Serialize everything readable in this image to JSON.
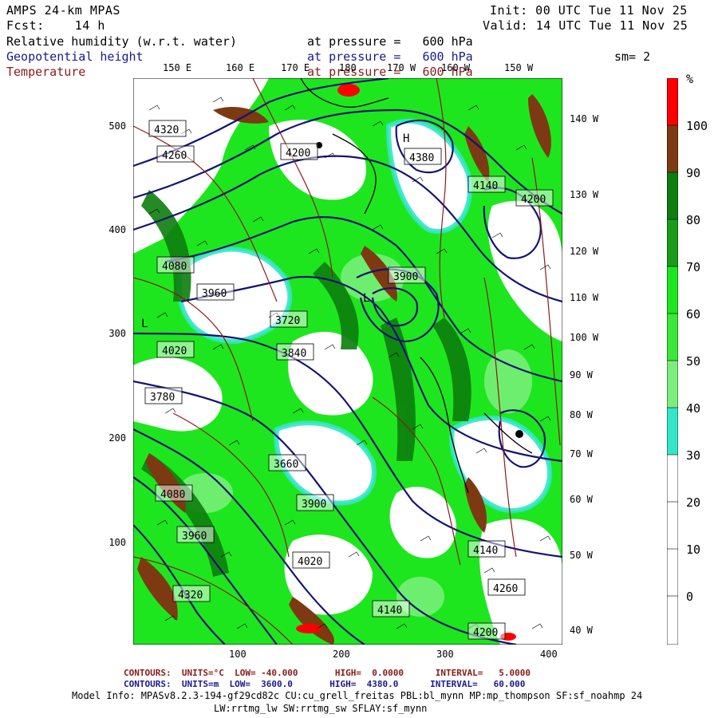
{
  "header": {
    "model": "AMPS 24-km MPAS",
    "fcst": "Fcst:    14 h",
    "init": "Init: 00 UTC Tue 11 Nov 25",
    "valid": "Valid: 14 UTC Tue 11 Nov 25",
    "fields": [
      {
        "name": "Relative humidity (w.r.t. water)",
        "level": "at pressure =   600 hPa",
        "color": "#000000"
      },
      {
        "name": "Geopotential height",
        "level": "at pressure =   600 hPa",
        "color": "#1a1a8c"
      },
      {
        "name": "Temperature",
        "level": "at pressure =   600 hPa",
        "color": "#8c1a1a"
      }
    ],
    "smoothing": "sm= 2"
  },
  "map": {
    "top_lon_labels": [
      "150 E",
      "160 E",
      "170 E",
      "180",
      "170 W",
      "160 W",
      "150 W"
    ],
    "right_lon_labels": [
      "140 W",
      "130 W",
      "120 W",
      "110 W",
      "100 W",
      "90 W",
      "80 W",
      "70 W",
      "60 W",
      "50 W",
      "40 W"
    ],
    "y_ticks": [
      "500",
      "400",
      "300",
      "200",
      "100"
    ],
    "x_ticks": [
      "100",
      "200",
      "300",
      "400"
    ],
    "height_labels": [
      "4320",
      "4260",
      "4200",
      "4380",
      "4140",
      "4080",
      "4020",
      "3960",
      "3900",
      "3840",
      "3780",
      "3720",
      "3660",
      "4200",
      "4140",
      "3900",
      "3960",
      "4080",
      "4020",
      "4140",
      "4200",
      "4260",
      "4320"
    ],
    "pressure_centers": [
      "H",
      "L",
      "L"
    ],
    "colors": {
      "white": "#ffffff",
      "cyan": "#33e6c8",
      "lightgreen": "#7dee7d",
      "green": "#1ee61e",
      "medgreen": "#2cbf2c",
      "darkgreen": "#0d7d0d",
      "brown": "#7d3a12",
      "red": "#ff0000",
      "height_contour": "#141473",
      "temp_contour": "#8c1a1a"
    }
  },
  "colorbar": {
    "unit": "%",
    "labels": [
      "100",
      "90",
      "80",
      "70",
      "60",
      "50",
      "40",
      "30",
      "20",
      "10",
      "0"
    ],
    "colors": [
      "#ff0000",
      "#7d3a12",
      "#0d7d0d",
      "#1a9c1a",
      "#1ee61e",
      "#3ce63c",
      "#7dee7d",
      "#33e6c8",
      "#ffffff",
      "#ffffff",
      "#ffffff",
      "#ffffff"
    ]
  },
  "footer": {
    "line1": "CONTOURS:  UNITS=°C  LOW= -40.000       HIGH=  0.0000      INTERVAL=   5.0000",
    "line2": "CONTOURS:  UNITS=m  LOW=  3600.0       HIGH=  4380.0      INTERVAL=   60.000",
    "line3": "Model Info: MPASv8.2.3-194-gf29cd82c CU:cu_grell_freitas PBL:bl_mynn MP:mp_thompson SF:sf_noahmp 24",
    "line4": "LW:rrtmg_lw SW:rrtmg_sw SFLAY:sf_mynn"
  }
}
